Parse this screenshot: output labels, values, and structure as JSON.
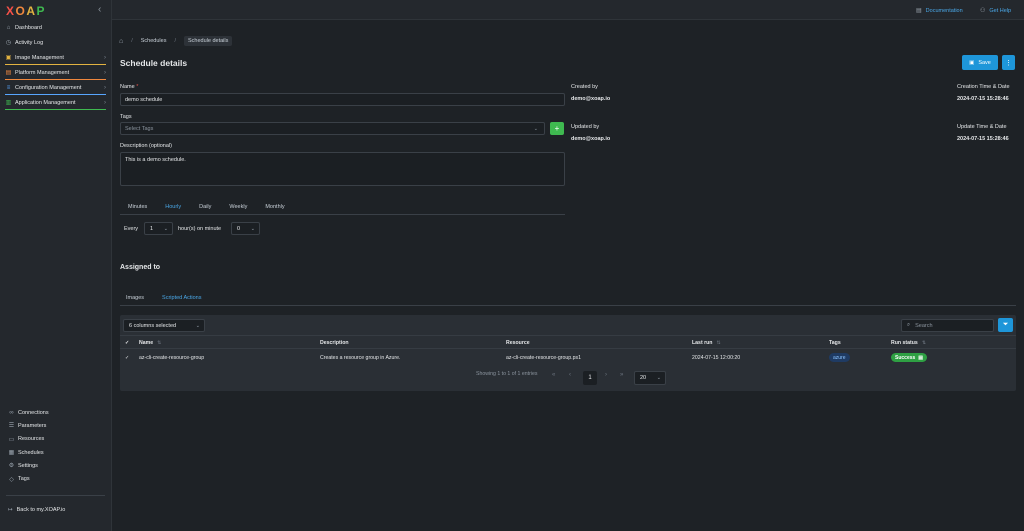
{
  "app": {
    "logo": "XOAP",
    "logo_colors": [
      "#f85149",
      "#f0883e",
      "#e3b341",
      "#3fb950",
      "#58a6ff",
      "#bc8cff"
    ]
  },
  "sidebar": {
    "items": [
      {
        "label": "Dashboard",
        "icon": "home-icon"
      },
      {
        "label": "Activity Log",
        "icon": "clock-icon"
      },
      {
        "label": "Image Management",
        "icon": "image-icon",
        "accent": "#e3b341"
      },
      {
        "label": "Platform Management",
        "icon": "server-icon",
        "accent": "#f0883e"
      },
      {
        "label": "Configuration Management",
        "icon": "sliders-icon",
        "accent": "#58a6ff"
      },
      {
        "label": "Application Management",
        "icon": "bar-chart-icon",
        "accent": "#3fb950"
      }
    ],
    "bottom_items": [
      {
        "label": "Connections",
        "icon": "link-icon"
      },
      {
        "label": "Parameters",
        "icon": "list-icon"
      },
      {
        "label": "Resources",
        "icon": "box-icon"
      },
      {
        "label": "Schedules",
        "icon": "calendar-icon"
      },
      {
        "label": "Settings",
        "icon": "gear-icon"
      },
      {
        "label": "Tags",
        "icon": "tag-icon"
      }
    ],
    "back_label": "Back to my.XOAP.io"
  },
  "topbar": {
    "documentation": "Documentation",
    "help": "Get Help"
  },
  "breadcrumb": {
    "parent": "Schedules",
    "current": "Schedule details"
  },
  "page": {
    "title": "Schedule details",
    "save_label": "Save"
  },
  "form": {
    "name_label": "Name",
    "name_required": "*",
    "name_value": "demo schedule",
    "tags_label": "Tags",
    "tags_placeholder": "Select Tags",
    "description_label": "Description (optional)",
    "description_value": "This is a demo schedule."
  },
  "meta": {
    "created_by_label": "Created by",
    "created_by": "demo@xoap.io",
    "creation_time_label": "Creation Time & Date",
    "creation_time": "2024-07-15 15:28:46",
    "updated_by_label": "Updated by",
    "updated_by": "demo@xoap.io",
    "update_time_label": "Update Time & Date",
    "update_time": "2024-07-15 15:28:46"
  },
  "frequency": {
    "tabs": [
      "Minutes",
      "Hourly",
      "Daily",
      "Weekly",
      "Monthly"
    ],
    "active": "Hourly",
    "every_label": "Every",
    "every_value": "1",
    "minute_label": "hour(s) on minute",
    "minute_value": "0"
  },
  "assigned": {
    "title": "Assigned to",
    "tabs": [
      "Images",
      "Scripted Actions"
    ],
    "active": "Scripted Actions"
  },
  "table": {
    "columns_selected": "6 columns selected",
    "search_placeholder": "Search",
    "headers": [
      "Name",
      "Description",
      "Resource",
      "Last run",
      "Tags",
      "Run status"
    ],
    "rows": [
      {
        "name": "az-cli-create-resource-group",
        "description": "Creates a resource group in Azure.",
        "resource": "az-cli-create-resource-group.ps1",
        "last_run": "2024-07-15 12:00:20",
        "tag": "azure",
        "status": "Success"
      }
    ],
    "pagination": {
      "summary": "Showing 1 to 1 of 1 entries",
      "current_page": "1",
      "page_size": "20"
    }
  }
}
